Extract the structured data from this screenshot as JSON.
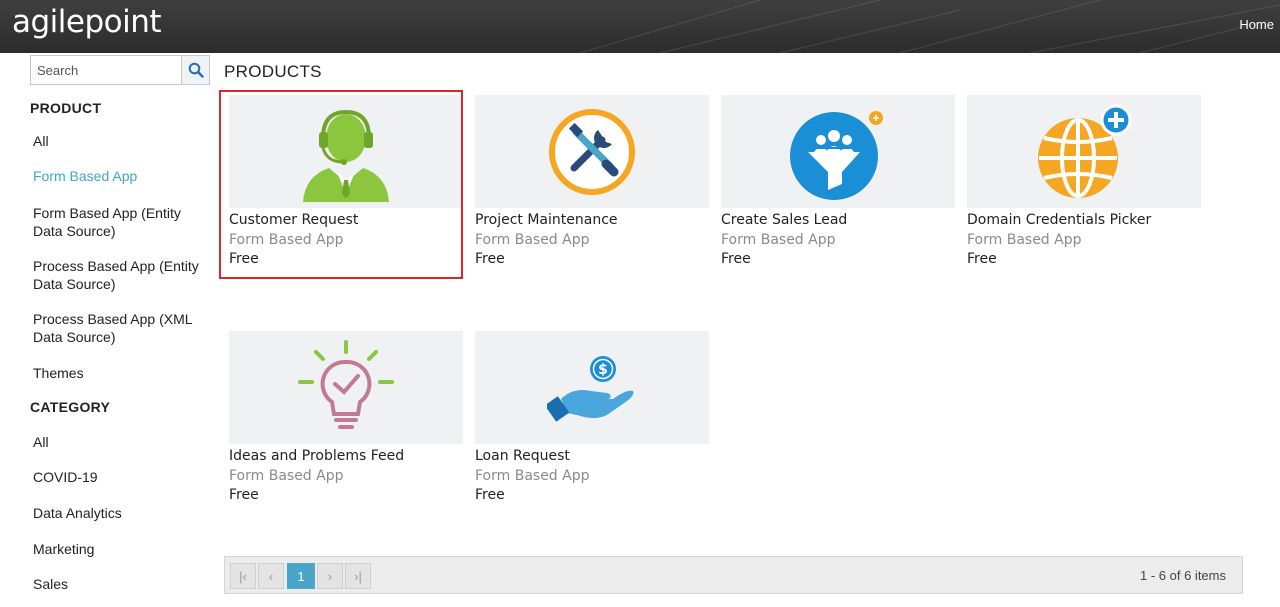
{
  "header": {
    "logo_text": "agilepoint",
    "home_label": "Home"
  },
  "sidebar": {
    "search_placeholder": "Search",
    "product_heading": "PRODUCT",
    "product_items": [
      {
        "label": "All"
      },
      {
        "label": "Form Based App"
      },
      {
        "label": "Form Based App (Entity Data Source)"
      },
      {
        "label": "Process Based App (Entity Data Source)"
      },
      {
        "label": "Process Based App (XML Data Source)"
      },
      {
        "label": "Themes"
      }
    ],
    "category_heading": "CATEGORY",
    "category_items": [
      {
        "label": "All"
      },
      {
        "label": "COVID-19"
      },
      {
        "label": "Data Analytics"
      },
      {
        "label": "Marketing"
      },
      {
        "label": "Sales"
      }
    ]
  },
  "main": {
    "title": "PRODUCTS",
    "products": [
      {
        "name": "Customer Request",
        "category": "Form Based App",
        "price": "Free",
        "icon": "headset-agent-icon"
      },
      {
        "name": "Project Maintenance",
        "category": "Form Based App",
        "price": "Free",
        "icon": "wrench-screwdriver-icon"
      },
      {
        "name": "Create Sales Lead",
        "category": "Form Based App",
        "price": "Free",
        "icon": "sales-funnel-icon"
      },
      {
        "name": "Domain Credentials Picker",
        "category": "Form Based App",
        "price": "Free",
        "icon": "globe-plus-icon"
      },
      {
        "name": "Ideas and Problems Feed",
        "category": "Form Based App",
        "price": "Free",
        "icon": "lightbulb-check-icon"
      },
      {
        "name": "Loan Request",
        "category": "Form Based App",
        "price": "Free",
        "icon": "hand-coin-icon"
      }
    ]
  },
  "pager": {
    "first": "|‹",
    "prev": "‹",
    "current_page": "1",
    "next": "›",
    "last": "›|",
    "info": "1 - 6 of 6 items"
  },
  "colors": {
    "accent": "#3fa7c4",
    "selection": "#d62a2a",
    "pager_active": "#4aa6c9"
  }
}
